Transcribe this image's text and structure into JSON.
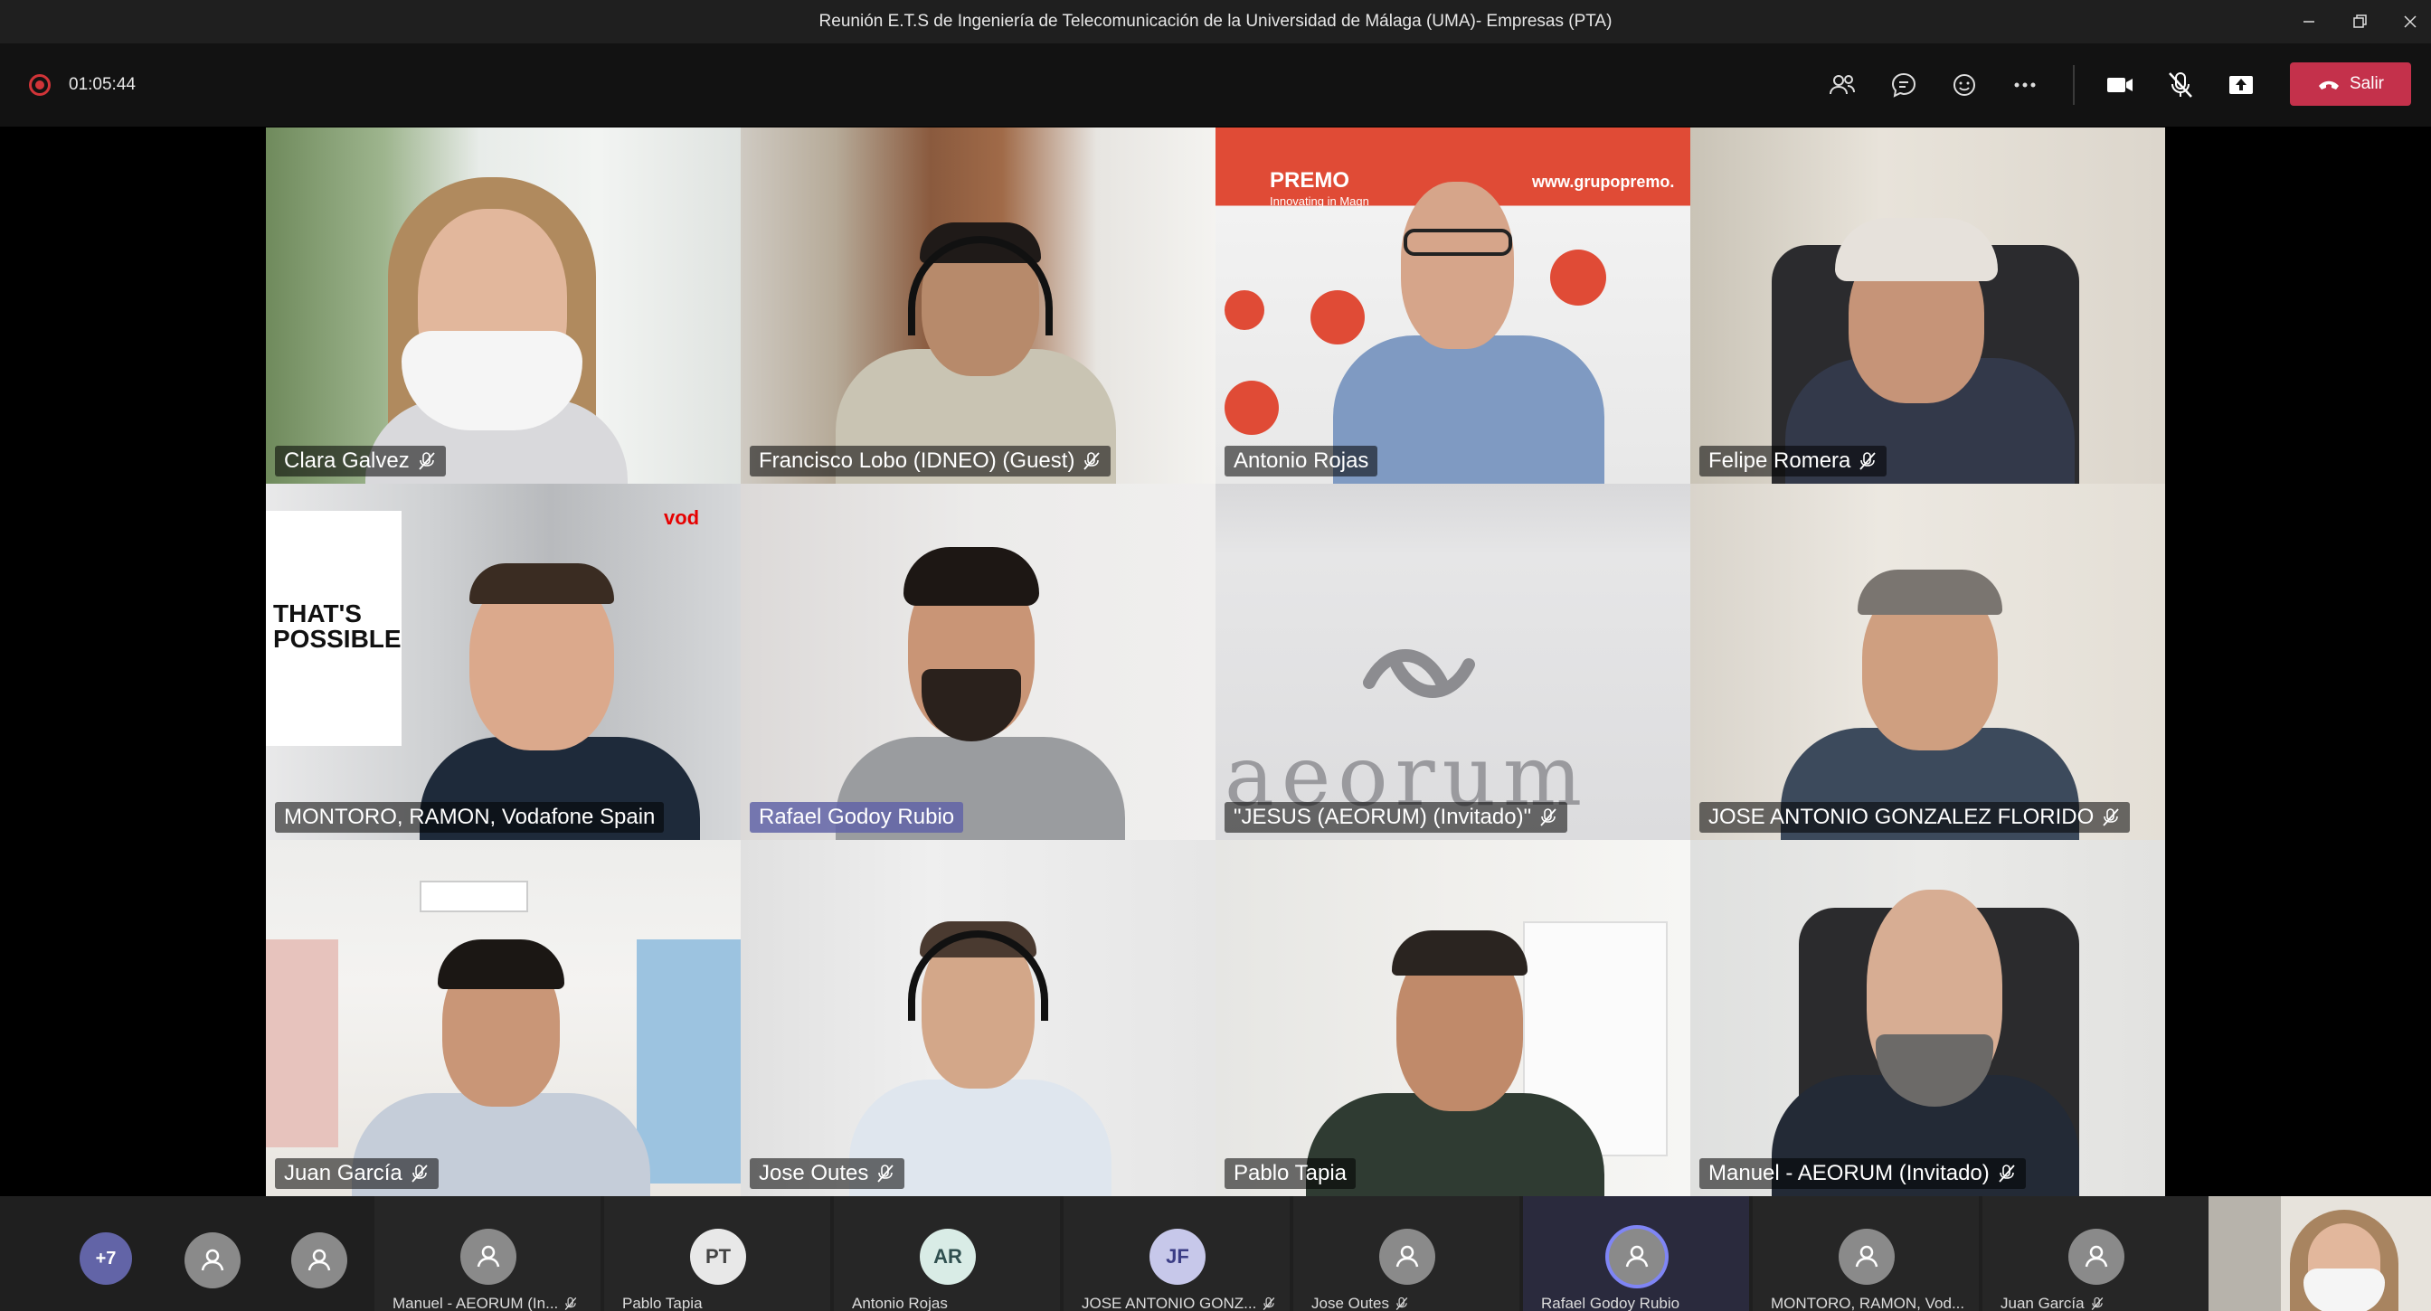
{
  "window": {
    "title": "Reunión E.T.S de Ingeniería de Telecomunicación de la Universidad de Málaga (UMA)- Empresas (PTA)"
  },
  "toolbar": {
    "recording_time": "01:05:44",
    "leave_label": "Salir",
    "leave_color": "#c4314b"
  },
  "grid": {
    "tiles": [
      {
        "name": "Clara Galvez",
        "muted": true
      },
      {
        "name": "Francisco Lobo (IDNEO) (Guest)",
        "muted": true
      },
      {
        "name": "Antonio Rojas",
        "muted": false
      },
      {
        "name": "Felipe Romera",
        "muted": true
      },
      {
        "name": "MONTORO, RAMON, Vodafone Spain",
        "muted": false
      },
      {
        "name": "Rafael Godoy Rubio",
        "muted": false,
        "speaking": true
      },
      {
        "name": "\"JESUS (AEORUM) (Invitado)\"",
        "muted": true
      },
      {
        "name": "JOSE ANTONIO GONZALEZ FLORIDO",
        "muted": true
      },
      {
        "name": "Juan García",
        "muted": true
      },
      {
        "name": "Jose Outes",
        "muted": true
      },
      {
        "name": "Pablo Tapia",
        "muted": false
      },
      {
        "name": "Manuel - AEORUM (Invitado)",
        "muted": true
      }
    ],
    "background_text": {
      "premo": "PREMO",
      "premo_tagline": "Innovating in Magn",
      "premo_url": "www.grupopremo.",
      "vodafone_poster": "THAT'S\nPOSSIBLE",
      "vodafone_logo": "vod",
      "aeorum": "aeorum"
    }
  },
  "strip": {
    "overflow_count": "+7",
    "participants": [
      {
        "label": "Manuel - AEORUM (In...",
        "initials": "",
        "muted": true
      },
      {
        "label": "Pablo Tapia",
        "initials": "PT",
        "muted": false
      },
      {
        "label": "Antonio Rojas",
        "initials": "AR",
        "muted": false
      },
      {
        "label": "JOSE ANTONIO GONZ...",
        "initials": "JF",
        "muted": true
      },
      {
        "label": "Jose Outes",
        "initials": "",
        "muted": true
      },
      {
        "label": "Rafael Godoy Rubio",
        "initials": "",
        "muted": false,
        "speaking": true
      },
      {
        "label": "MONTORO, RAMON, Vod...",
        "initials": "",
        "muted": false
      },
      {
        "label": "Juan García",
        "initials": "",
        "muted": true
      }
    ]
  },
  "colors": {
    "accent": "#6264a7",
    "recording": "#d13438",
    "speaking_ring": "#7f85f5"
  }
}
